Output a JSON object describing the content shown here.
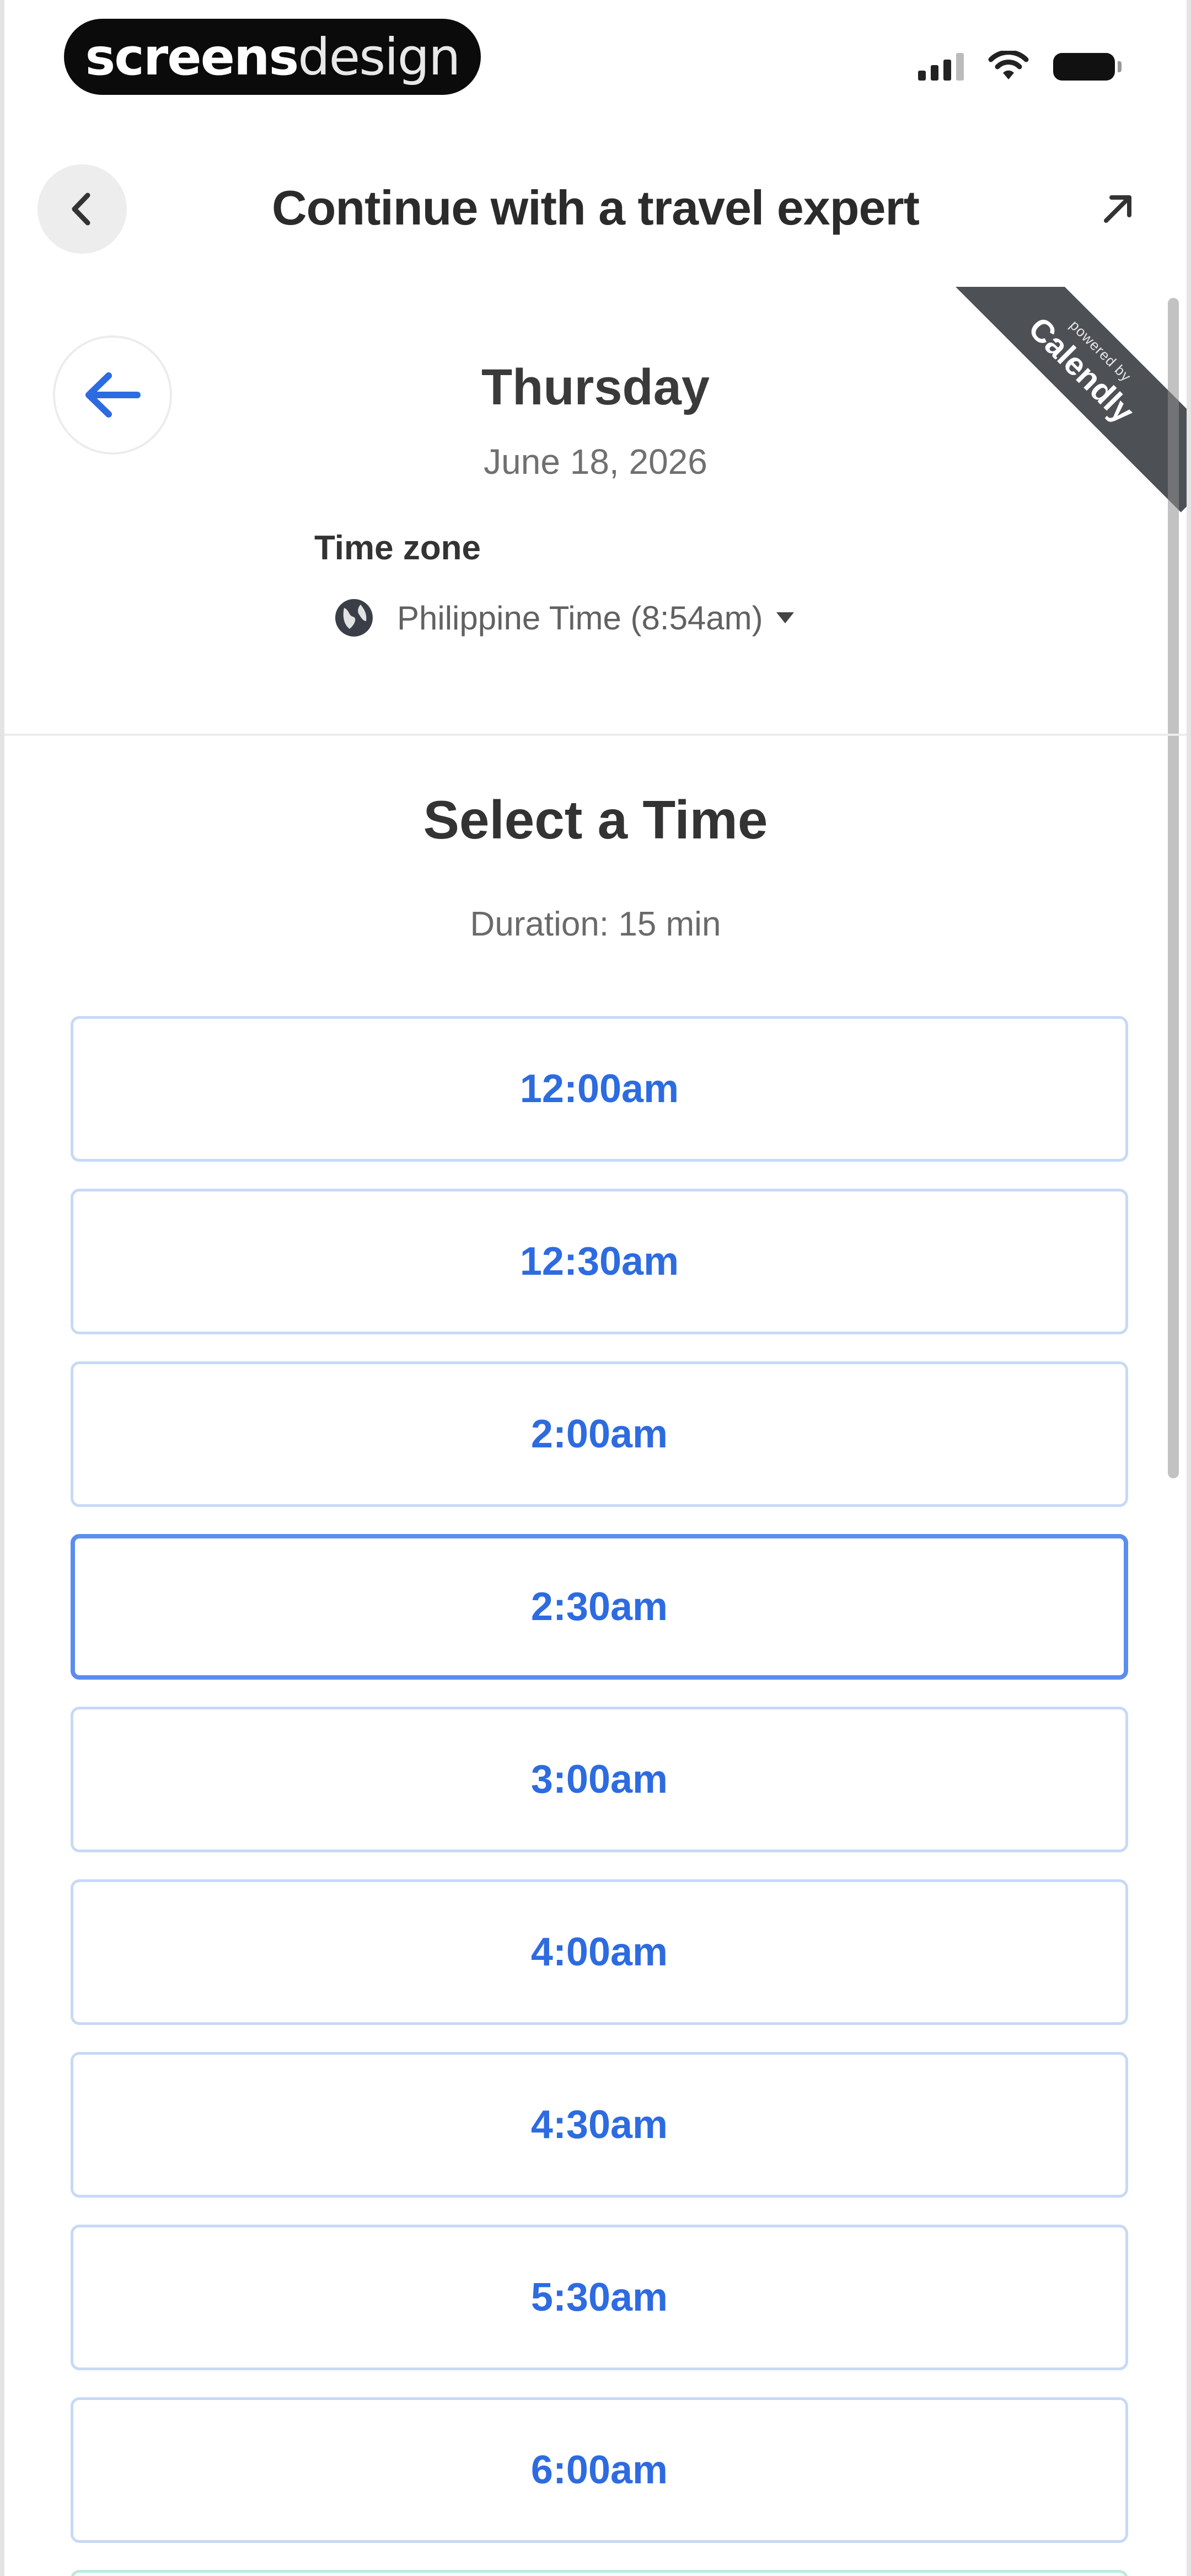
{
  "status_bar": {
    "brand_bold": "screens",
    "brand_light": "design",
    "icons": [
      "signal-icon",
      "wifi-icon",
      "battery-icon"
    ]
  },
  "header": {
    "title": "Continue with a travel expert",
    "back_icon": "chevron-left-icon",
    "external_icon": "external-link-icon"
  },
  "ribbon": {
    "line1": "powered by",
    "line2": "Calendly"
  },
  "date_block": {
    "day": "Thursday",
    "date": "June 18, 2026",
    "timezone_label": "Time zone",
    "timezone_value": "Philippine Time (8:54am)"
  },
  "time_selector": {
    "title": "Select a Time",
    "duration": "Duration: 15 min",
    "slots": [
      "12:00am",
      "12:30am",
      "2:00am",
      "2:30am",
      "3:00am",
      "4:00am",
      "4:30am",
      "5:30am",
      "6:00am"
    ],
    "selected_slot": "2:30am"
  },
  "colors": {
    "accent": "#2d6be0",
    "slot_border": "#c7d9f6",
    "ribbon": "#4d5055"
  }
}
